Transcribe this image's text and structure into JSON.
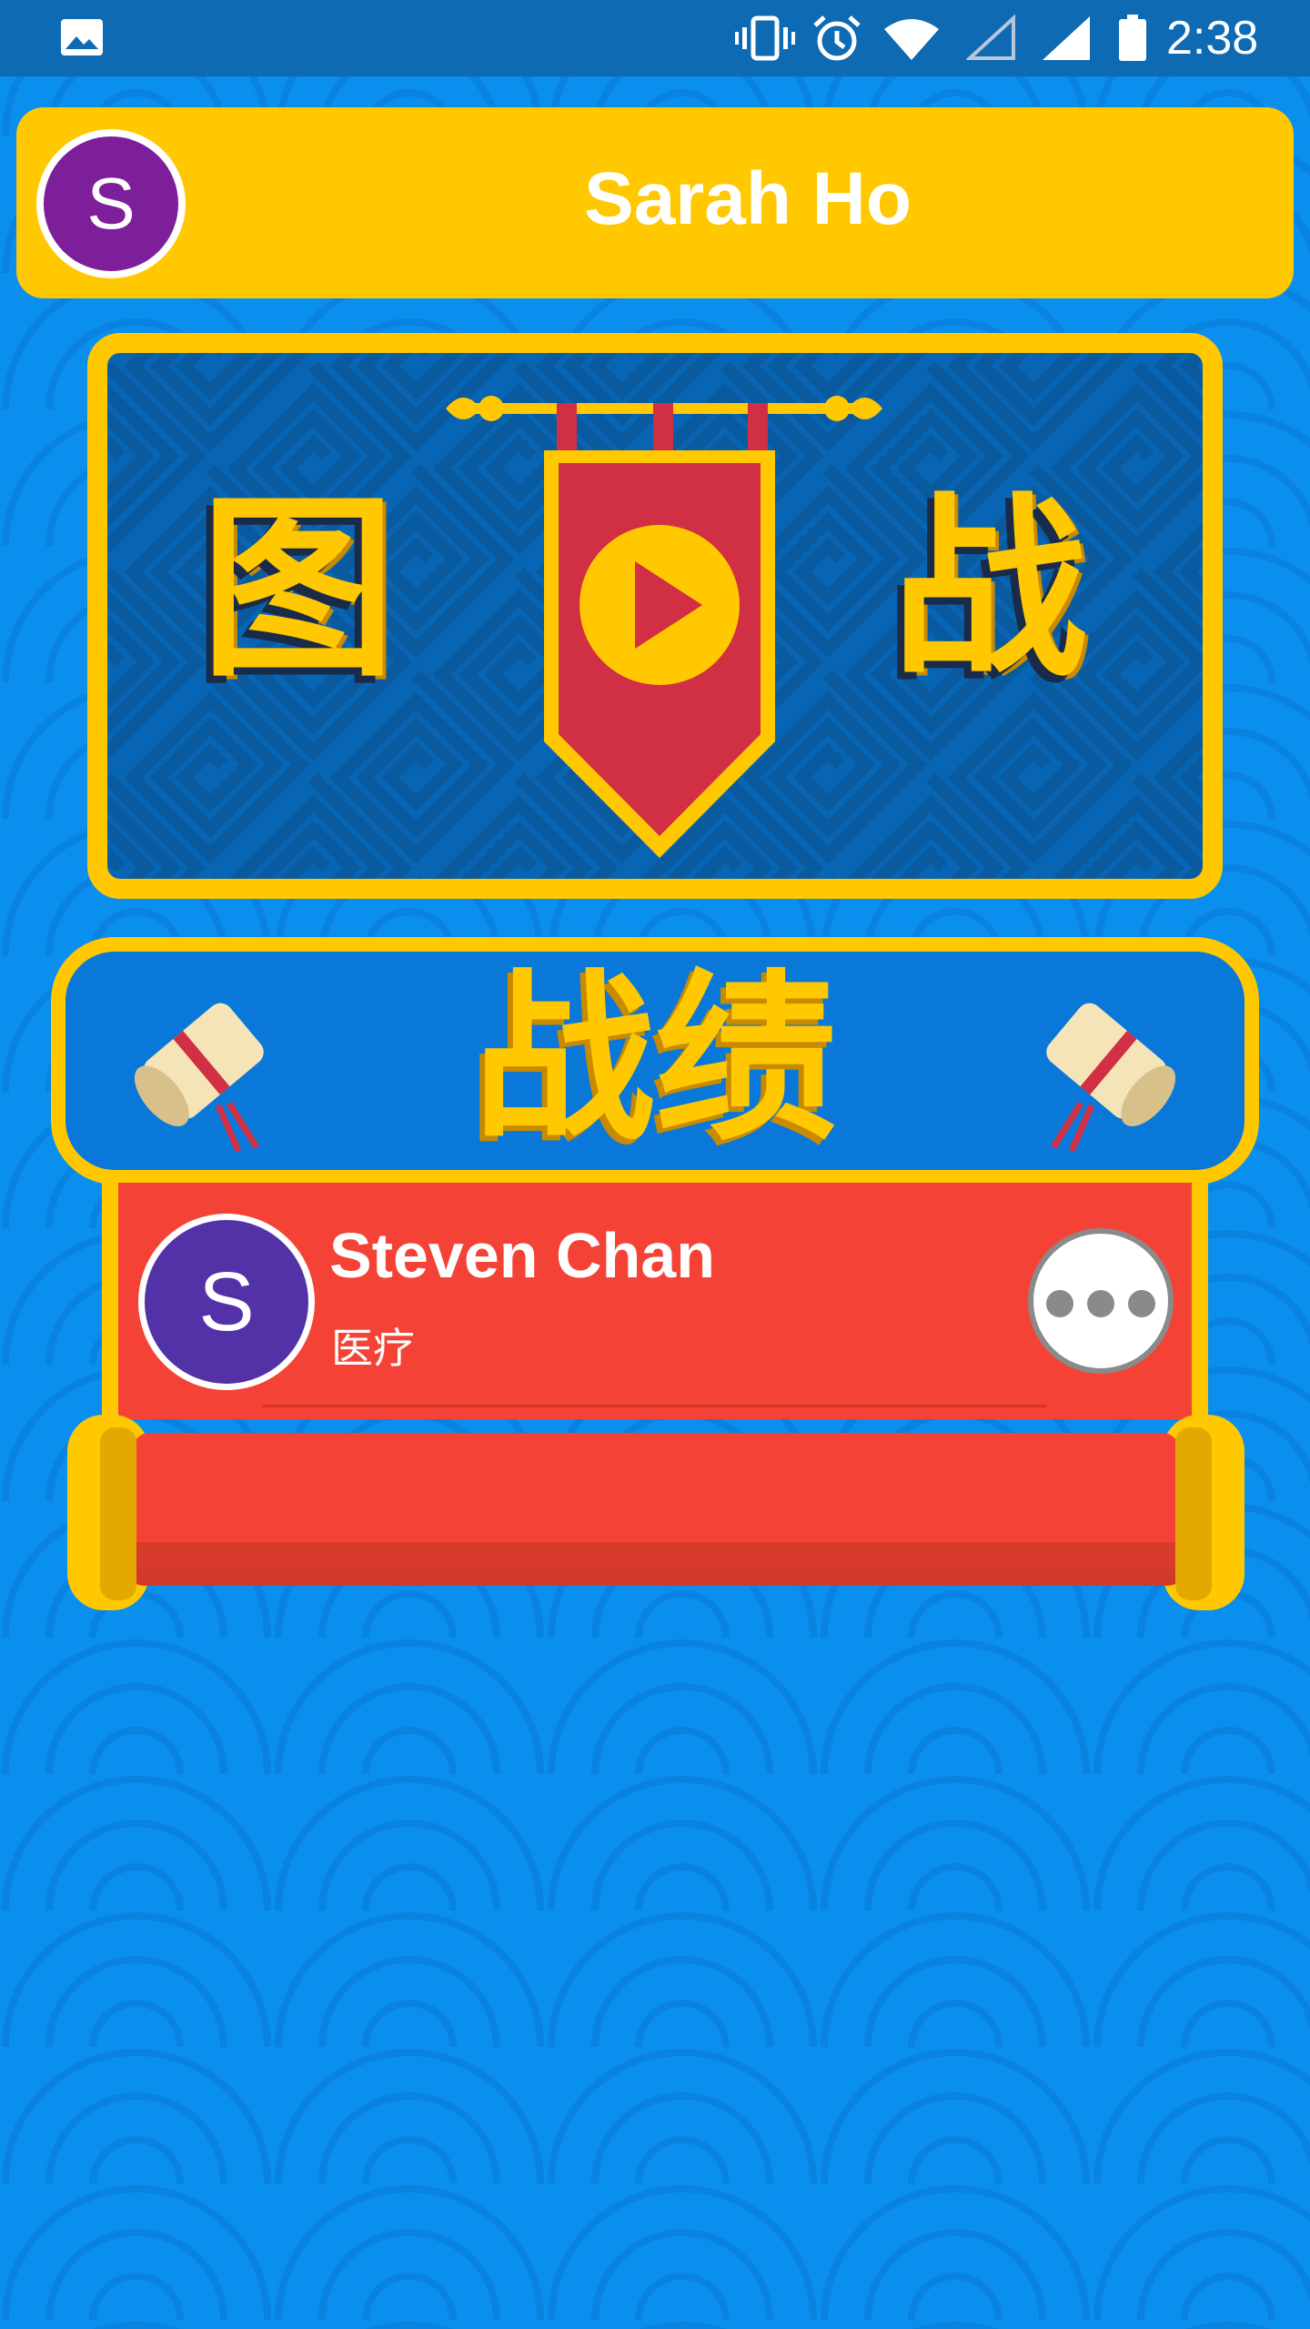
{
  "status_bar": {
    "time": "2:38",
    "icons": [
      "gallery-icon",
      "vibrate-icon",
      "alarm-icon",
      "wifi-icon",
      "no-signal-icon",
      "signal-icon",
      "battery-icon"
    ]
  },
  "header": {
    "avatar_letter": "S",
    "user_name": "Sarah Ho"
  },
  "play_banner": {
    "left_char": "图",
    "right_char": "战",
    "play_icon": "play-icon"
  },
  "records": {
    "title": "战绩"
  },
  "list": [
    {
      "avatar_letter": "S",
      "name": "Steven Chan",
      "subtitle": "医疗",
      "more_icon": "more-icon"
    }
  ],
  "colors": {
    "background": "#0b8fef",
    "gold": "#ffc800",
    "card_red": "#f44336",
    "header_avatar": "#7d1e9b",
    "list_avatar": "#5331a6",
    "banner_blue": "#0865b4",
    "pennant_red": "#d12f43"
  }
}
